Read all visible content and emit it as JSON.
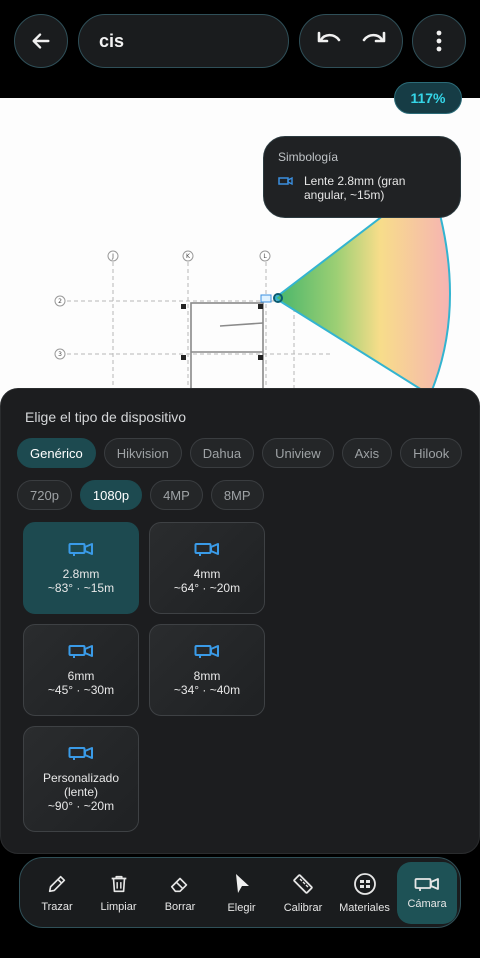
{
  "header": {
    "title": "cis"
  },
  "zoom_level": "117%",
  "legend": {
    "title": "Simbología",
    "item": "Lente 2.8mm (gran angular, ~15m)"
  },
  "grid_labels": {
    "j": "J",
    "k": "K",
    "l": "L",
    "r2": "2",
    "r3": "3",
    "r2b": "2"
  },
  "sheet": {
    "title": "Elige el tipo de dispositivo",
    "brands": [
      "Genérico",
      "Hikvision",
      "Dahua",
      "Uniview",
      "Axis",
      "Hilook"
    ],
    "resolutions": [
      "720p",
      "1080p",
      "4MP",
      "8MP"
    ],
    "lenses": [
      {
        "line1": "2.8mm",
        "line2": "~83° · ~15m"
      },
      {
        "line1": "4mm",
        "line2": "~64° · ~20m"
      },
      {
        "line1": "6mm",
        "line2": "~45° · ~30m"
      },
      {
        "line1": "8mm",
        "line2": "~34° · ~40m"
      },
      {
        "line1": "Personalizado",
        "line1b": "(lente)",
        "line2": "~90° · ~20m"
      }
    ]
  },
  "toolbar": [
    "Trazar",
    "Limpiar",
    "Borrar",
    "Elegir",
    "Calibrar",
    "Materiales",
    "Cámara"
  ],
  "colors": {
    "accent": "#35d6e8",
    "active_bg": "#1d4a50",
    "camera_icon": "#3a8fe0"
  }
}
